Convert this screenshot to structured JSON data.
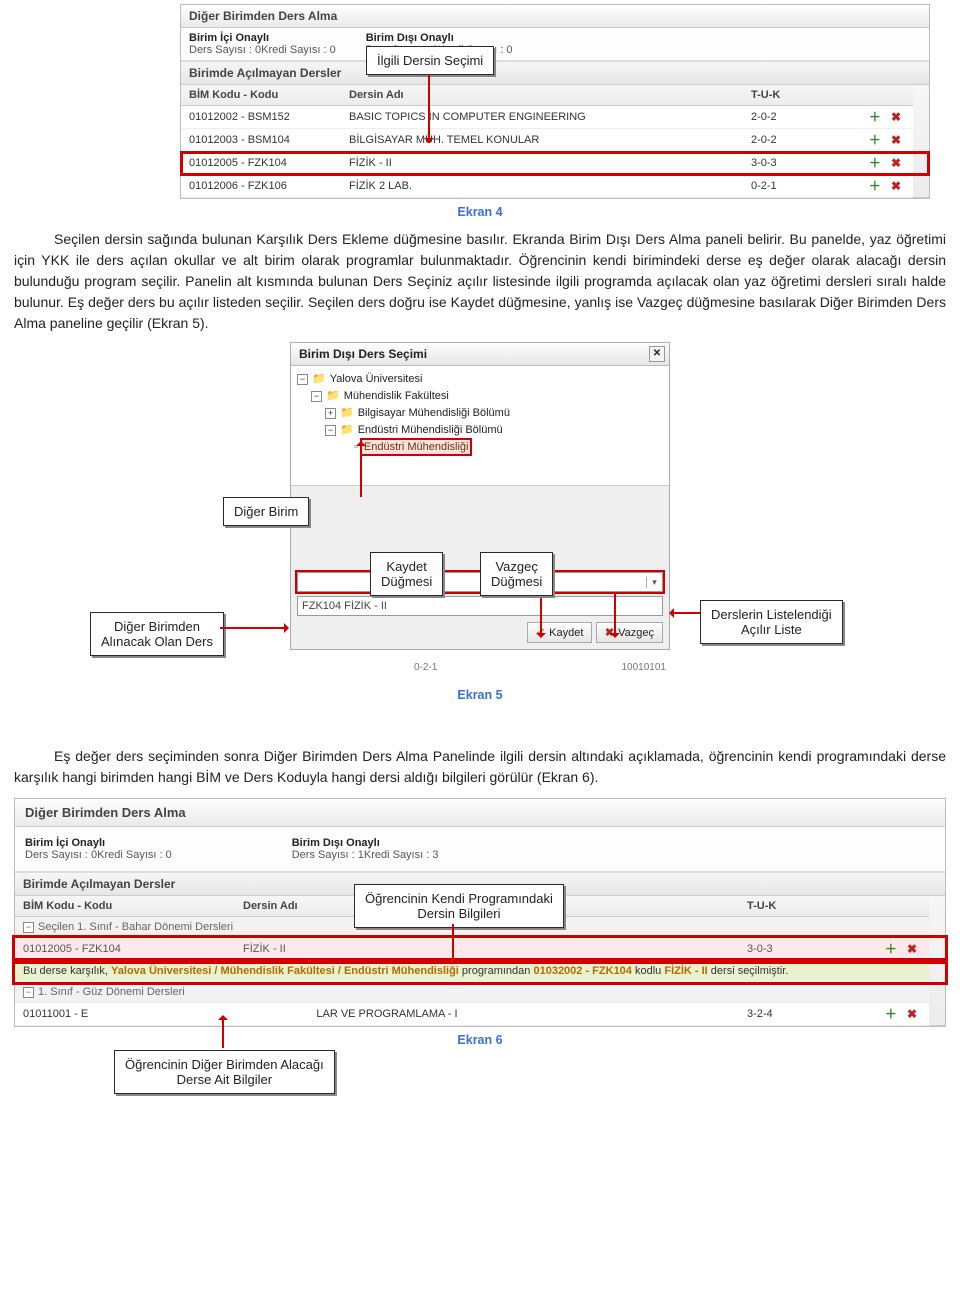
{
  "ekran4": {
    "panel_title": "Diğer Birimden Ders Alma",
    "approvals": {
      "in_label": "Birim İçi Onaylı",
      "in_detail": "Ders Sayısı : 0Kredi Sayısı : 0",
      "out_label": "Birim Dışı Onaylı",
      "out_detail": "Ders Sayısı : 0Kredi Sayısı : 0"
    },
    "section": "Birimde Açılmayan Dersler",
    "callout": "İlgili Dersin Seçimi",
    "columns": {
      "c1": "BİM Kodu - Kodu",
      "c2": "Dersin Adı",
      "c3": "T-U-K"
    },
    "rows": [
      {
        "code": "01012002 - BSM152",
        "name": "BASIC TOPICS İN COMPUTER ENGINEERING",
        "tuk": "2-0-2"
      },
      {
        "code": "01012003 - BSM104",
        "name": "BİLGİSAYAR MÜH. TEMEL KONULAR",
        "tuk": "2-0-2"
      },
      {
        "code": "01012005 - FZK104",
        "name": "FİZİK - II",
        "tuk": "3-0-3"
      },
      {
        "code": "01012006 - FZK106",
        "name": "FİZİK 2 LAB.",
        "tuk": "0-2-1"
      }
    ],
    "caption": "Ekran 4"
  },
  "para1": "Seçilen dersin sağında bulunan Karşılık Ders Ekleme düğmesine basılır. Ekranda Birim Dışı Ders Alma paneli belirir. Bu panelde, yaz öğretimi için YKK ile ders açılan okullar ve alt birim olarak programlar bulunmaktadır. Öğrencinin kendi birimindeki derse eş değer olarak alacağı dersin bulunduğu program seçilir. Panelin alt kısmında bulunan Ders Seçiniz açılır listesinde ilgili programda açılacak olan yaz öğretimi dersleri sıralı halde bulunur. Eş değer ders bu açılır listeden seçilir. Seçilen ders doğru ise Kaydet düğmesine, yanlış ise Vazgeç düğmesine basılarak Diğer Birimden Ders Alma paneline geçilir (Ekran 5).",
  "ekran5": {
    "dialog_title": "Birim Dışı Ders Seçimi",
    "tree": {
      "n1": "Yalova Üniversitesi",
      "n2": "Mühendislik Fakültesi",
      "n3": "Bilgisayar Mühendisliği Bölümü",
      "n4": "Endüstri Mühendisliği Bölümü",
      "n5": "Endüstri Mühendisliği"
    },
    "callouts": {
      "diger_birim": "Diğer Birim",
      "kaydet": "Kaydet\nDüğmesi",
      "vazgec": "Vazgeç\nDüğmesi",
      "diger_birimden": "Diğer Birimden\nAlınacak Olan Ders",
      "listeleme": "Derslerin Listelendiği\nAçılır Liste"
    },
    "combo_value": "FZK104 FİZİK - II",
    "btn_save": "Kaydet",
    "btn_cancel": "Vazgeç",
    "below_left": "0-2-1",
    "below_right": "10010101",
    "caption": "Ekran 5"
  },
  "para2": "Eş değer ders seçiminden sonra Diğer Birimden Ders Alma Panelinde ilgili dersin altındaki açıklamada, öğrencinin kendi programındaki derse karşılık hangi birimden hangi BİM ve Ders Koduyla hangi dersi aldığı bilgileri görülür (Ekran 6).",
  "ekran6": {
    "panel_title": "Diğer Birimden Ders Alma",
    "approvals": {
      "in_label": "Birim İçi Onaylı",
      "in_detail": "Ders Sayısı : 0Kredi Sayısı : 0",
      "out_label": "Birim Dışı Onaylı",
      "out_detail": "Ders Sayısı : 1Kredi Sayısı : 3"
    },
    "section": "Birimde Açılmayan Dersler",
    "columns": {
      "c1": "BİM Kodu - Kodu",
      "c2": "Dersin Adı",
      "c3": "T-U-K"
    },
    "group1": "Seçilen 1. Sınıf - Bahar Dönemi Dersleri",
    "row_sel": {
      "code": "01012005 - FZK104",
      "name": "FİZİK - II",
      "tuk": "3-0-3"
    },
    "info": {
      "p1": "Bu derse karşılık, ",
      "p2": "Yalova Üniversitesi / Mühendislik Fakültesi / Endüstri Mühendisliği",
      "p3": " programından ",
      "p4": "01032002 - FZK104",
      "p5": " kodlu ",
      "p6": "FİZİK - II",
      "p7": " dersi seçilmiştir."
    },
    "group2": "1. Sınıf - Güz Dönemi Dersleri",
    "row_other": {
      "code": "01011001 - E",
      "name_suffix": "LAR VE PROGRAMLAMA - I",
      "tuk": "3-2-4"
    },
    "callouts": {
      "top": "Öğrencinin Kendi Programındaki\nDersin Bilgileri",
      "bottom": "Öğrencinin Diğer Birimden Alacağı\nDerse Ait Bilgiler"
    },
    "caption": "Ekran 6"
  }
}
